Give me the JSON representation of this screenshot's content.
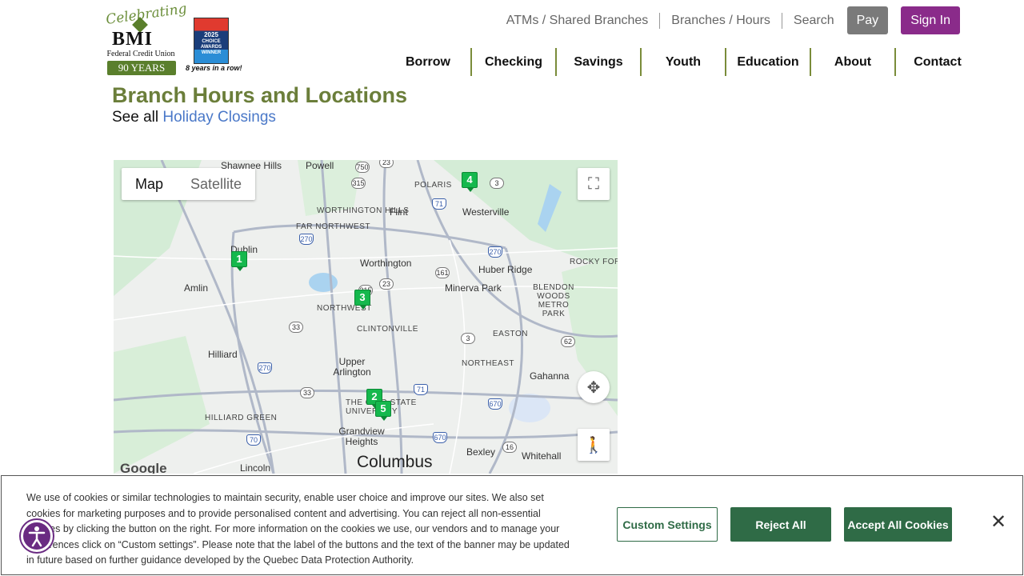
{
  "header": {
    "logo": {
      "celebrating": "Celebrating",
      "bmi": "BMI",
      "subtitle": "Federal Credit Union",
      "years": "90 YEARS"
    },
    "award": {
      "year": "2025",
      "text": "CHOICE AWARDS WINNER",
      "caption": "8 years in a row!"
    },
    "utility_links": [
      "ATMs / Shared Branches",
      "Branches / Hours",
      "Search"
    ],
    "pay_label": "Pay",
    "signin_label": "Sign In",
    "main_nav": [
      "Borrow",
      "Checking",
      "Savings",
      "Youth",
      "Education",
      "About",
      "Contact"
    ]
  },
  "content": {
    "title": "Branch Hours and Locations",
    "see_all_prefix": "See all ",
    "holiday_link": "Holiday Closings"
  },
  "map": {
    "type_map": "Map",
    "type_satellite": "Satellite",
    "google": "Google",
    "places": {
      "shawnee_hills": "Shawnee Hills",
      "powell": "Powell",
      "polaris": "POLARIS",
      "westerville": "Westerville",
      "worthington_hills": "WORTHINGTON HILLS",
      "flint": "Flint",
      "far_northwest": "FAR NORTHWEST",
      "dublin": "Dublin",
      "worthington": "Worthington",
      "huber_ridge": "Huber Ridge",
      "rocky_fork": "ROCKY FORK-BLACKLICK",
      "amlin": "Amlin",
      "minerva_park": "Minerva Park",
      "blendon_woods": "BLENDON WOODS METRO PARK",
      "northwest": "NORTHWEST",
      "clintonville": "CLINTONVILLE",
      "easton": "EASTON",
      "hilliard": "Hilliard",
      "upper_arlington": "Upper Arlington",
      "northeast": "NORTHEAST",
      "gahanna": "Gahanna",
      "ohio_state": "THE OHIO STATE UNIVERSITY",
      "hilliard_green": "HILLIARD GREEN",
      "grandview": "Grandview Heights",
      "columbus": "Columbus",
      "bexley": "Bexley",
      "whitehall": "Whitehall",
      "lincoln": "Lincoln"
    },
    "markers": [
      "1",
      "2",
      "3",
      "4",
      "5"
    ],
    "routes": [
      "750",
      "23",
      "315",
      "71",
      "3",
      "270",
      "161",
      "270",
      "23",
      "315",
      "33",
      "3",
      "62",
      "270",
      "71",
      "33",
      "670",
      "70",
      "670",
      "16"
    ]
  },
  "cookie": {
    "text": "We use of cookies or similar technologies to maintain security, enable user choice and improve our sites. We also set cookies for marketing purposes and to provide personalised content and advertising. You can reject all non-essential cookies by clicking the button on the right. For more information on the cookies we use, our vendors and to manage your preferences click on “Custom settings”. Please note that the label of the buttons and the text of the banner may be updated in future based on further guidance developed by the Quebec Data Protection Authority.",
    "custom_label": "Custom Settings",
    "reject_label": "Reject All",
    "accept_label": "Accept All Cookies"
  },
  "colors": {
    "brand_green": "#6b7e3a",
    "brand_purple": "#8a2b8a",
    "cookie_green": "#2f6b46",
    "marker_green": "#15b84d"
  }
}
